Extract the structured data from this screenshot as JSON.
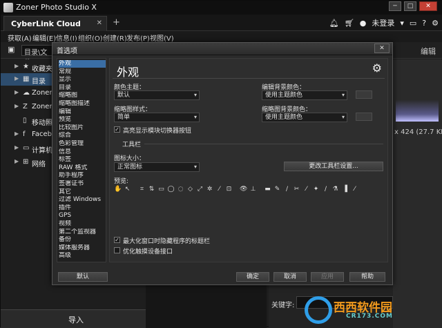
{
  "window": {
    "title": "Zoner Photo Studio X",
    "controls": [
      "─",
      "□",
      "✕"
    ]
  },
  "tabbar": {
    "tab_label": "CyberLink Cloud",
    "tab_close": "✕",
    "new_tab": "+",
    "user_label": "未登录",
    "icons": [
      "bell-icon",
      "cart-icon",
      "user-icon",
      "monitor-icon",
      "help-icon",
      "gear-icon"
    ]
  },
  "menu": {
    "items": [
      "获取(A)",
      "编辑(E)",
      "信息(I)",
      "组织(O)",
      "创建(R)",
      "发布(P)",
      "视图(V)"
    ]
  },
  "row3": {
    "path_label": "目录\\文件",
    "right_tab": "编辑"
  },
  "leftnav": {
    "items": [
      {
        "label": "收藏夹",
        "icon": "★"
      },
      {
        "label": "目录",
        "icon": "▦"
      },
      {
        "label": "Zoner",
        "icon": "☁"
      },
      {
        "label": "Zoner",
        "icon": "Z"
      },
      {
        "label": "移动照",
        "icon": "▯"
      },
      {
        "label": "Faceb",
        "icon": "f"
      },
      {
        "label": "计算机",
        "icon": "▭"
      },
      {
        "label": "网络",
        "icon": "⊞"
      }
    ],
    "import_label": "导入"
  },
  "rightpanel": {
    "info_text": "x 424 (27.7 KB)",
    "keyword_label": "关键字:"
  },
  "dialog": {
    "title": "首选项",
    "close": "✕",
    "categories": [
      "外观",
      "常规",
      "显示",
      "目录",
      "缩略图",
      "缩略图描述",
      "编辑",
      "预览",
      "比较图片",
      "综合",
      "色彩管理",
      "信息",
      "标签",
      "RAW 格式",
      "助手程序",
      "签署证书",
      "其它",
      "过滤 Windows",
      "插件",
      "GPS",
      "视频",
      "第二个监视器",
      "备份",
      "媒体服务器",
      "高级"
    ],
    "selected_category": 0,
    "heading": "外观",
    "color_theme_label": "颜色主题：",
    "color_theme_value": "默认",
    "edit_bg_label": "编辑背景颜色：",
    "edit_bg_value": "使用主题颜色",
    "thumb_style_label": "缩略图样式：",
    "thumb_style_value": "简单",
    "thumb_bg_label": "缩略图背景颜色：",
    "thumb_bg_value": "使用主题颜色",
    "highlight_label": "高亮显示模块切换器按钮",
    "highlight_checked": true,
    "toolbar_section": "工具栏",
    "icon_size_label": "图标大小：",
    "icon_size_value": "正常图标",
    "change_toolbar_btn": "更改工具栏设置...",
    "preview_label": "预览:",
    "tool_icons": [
      "✋",
      "↖",
      "⌗",
      "⇅",
      "▭",
      "◯",
      "◌",
      "◇",
      "⤢",
      "✲",
      "⁄",
      "⊡",
      "👁",
      "⊥",
      "▬",
      "✎",
      "∕",
      "✂",
      "⁄",
      "✦",
      "∕",
      "⚗",
      "▐",
      "⁄"
    ],
    "maximize_label": "最大化窗口时隐藏程序的标题栏",
    "maximize_checked": true,
    "touch_label": "优化触摸设备接口",
    "touch_checked": false,
    "btn_default": "默认",
    "btn_ok": "确定",
    "btn_cancel": "取消",
    "btn_apply": "应用",
    "btn_help": "帮助"
  },
  "watermark": {
    "text": "西西软件园",
    "sub": "CR173.COM"
  }
}
